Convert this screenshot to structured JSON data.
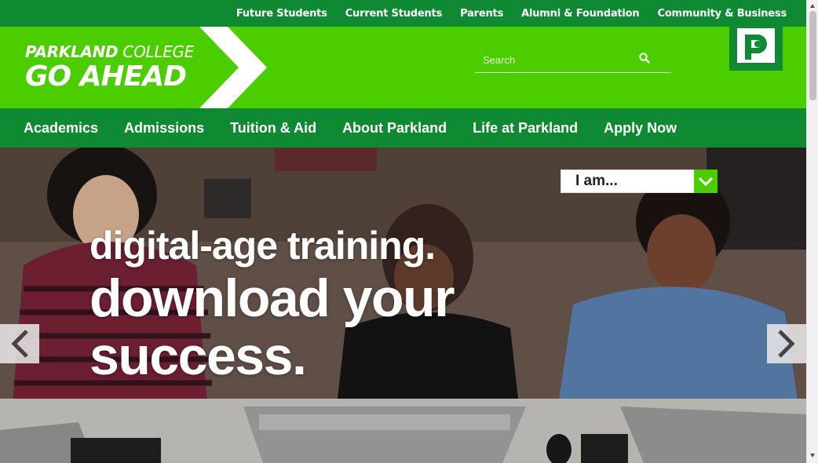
{
  "utility_nav": {
    "items": [
      {
        "label": "Future Students"
      },
      {
        "label": "Current Students"
      },
      {
        "label": "Parents"
      },
      {
        "label": "Alumni & Foundation"
      },
      {
        "label": "Community & Business"
      }
    ]
  },
  "brand": {
    "name_bold": "PARKLAND",
    "name_light": " COLLEGE",
    "tagline": "GO AHEAD"
  },
  "search": {
    "placeholder": "Search",
    "value": ""
  },
  "logo": {
    "icon": "parkland-p-logo-icon"
  },
  "main_nav": {
    "items": [
      {
        "label": "Academics"
      },
      {
        "label": "Admissions"
      },
      {
        "label": "Tuition & Aid"
      },
      {
        "label": "About Parkland"
      },
      {
        "label": "Life at Parkland"
      },
      {
        "label": "Apply Now"
      }
    ]
  },
  "hero": {
    "selector_label": "I am...",
    "headline": {
      "line1": "digital-age training.",
      "line2": "download your",
      "line3": "success."
    }
  },
  "colors": {
    "brand_green": "#4ccd00",
    "dark_green": "#0f8a32",
    "white": "#ffffff"
  }
}
